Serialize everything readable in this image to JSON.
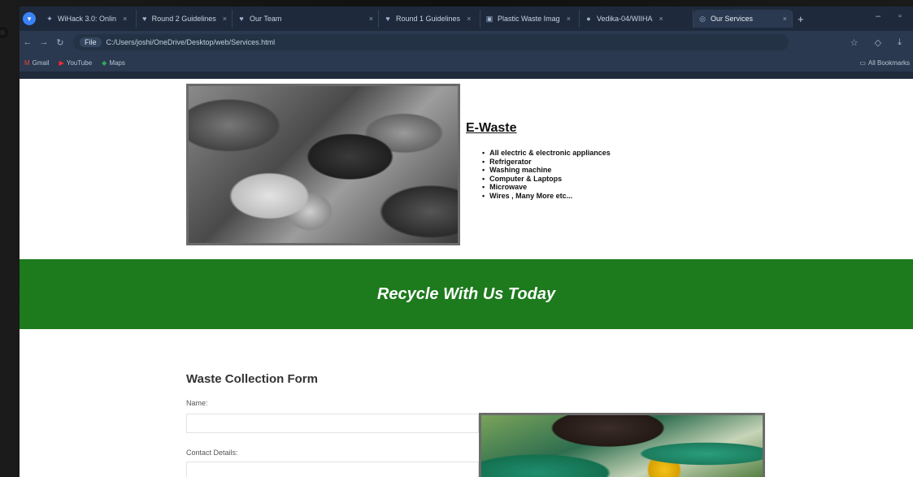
{
  "browser": {
    "tabs": [
      {
        "label": "WiHack 3.0: Onlin",
        "icon": "hackathon-icon",
        "active": false
      },
      {
        "label": "Round 2 Guidelines",
        "icon": "devfolio-icon",
        "active": false
      },
      {
        "label": "Our Team",
        "icon": "devfolio-icon",
        "active": false
      },
      {
        "label": "Round 1 Guidelines",
        "icon": "devfolio-icon",
        "active": false
      },
      {
        "label": "Plastic Waste Imag",
        "icon": "image-icon",
        "active": false
      },
      {
        "label": "Vedika-04/WIIHA",
        "icon": "github-icon",
        "active": false
      },
      {
        "label": "Our Services",
        "icon": "globe-icon",
        "active": true
      }
    ],
    "new_tab_label": "+",
    "url_chip": "File",
    "url": "C:/Users/joshi/OneDrive/Desktop/web/Services.html",
    "bookmarks": [
      {
        "label": "Gmail",
        "icon": "gmail-icon"
      },
      {
        "label": "YouTube",
        "icon": "youtube-icon"
      },
      {
        "label": "Maps",
        "icon": "maps-icon"
      }
    ],
    "all_bookmarks_label": "All Bookmarks"
  },
  "ewaste": {
    "title": "E-Waste",
    "items": [
      "All electric & electronic appliances",
      "Refrigerator",
      "Washing machine",
      "Computer & Laptops",
      "Microwave",
      "Wires , Many More etc..."
    ]
  },
  "banner": {
    "text": "Recycle With Us Today"
  },
  "form": {
    "title": "Waste Collection Form",
    "name_label": "Name:",
    "contact_label": "Contact Details:"
  },
  "colors": {
    "banner": "#1d7a1d",
    "chrome": "#2b3950"
  }
}
